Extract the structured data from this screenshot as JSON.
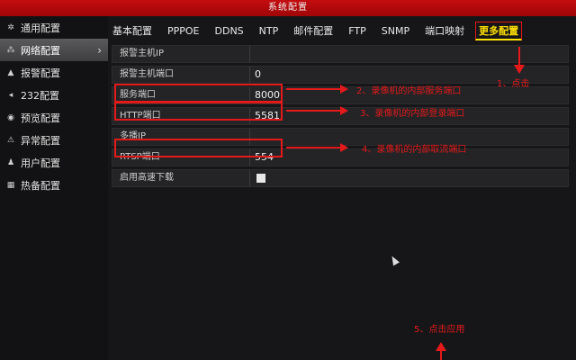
{
  "window": {
    "title": "系统配置"
  },
  "sidebar": {
    "items": [
      {
        "icon": "gear-icon",
        "glyph": "✲",
        "label": "通用配置"
      },
      {
        "icon": "network-icon",
        "glyph": "⁂",
        "label": "网络配置",
        "active": true,
        "chevron": "›"
      },
      {
        "icon": "alarm-icon",
        "glyph": "▲",
        "label": "报警配置"
      },
      {
        "icon": "rs232-icon",
        "glyph": "◂",
        "label": "232配置"
      },
      {
        "icon": "eye-icon",
        "glyph": "◉",
        "label": "预览配置"
      },
      {
        "icon": "warning-icon",
        "glyph": "⚠",
        "label": "异常配置"
      },
      {
        "icon": "user-icon",
        "glyph": "♟",
        "label": "用户配置"
      },
      {
        "icon": "hotspare-icon",
        "glyph": "▦",
        "label": "热备配置"
      }
    ]
  },
  "tabs": [
    {
      "label": "基本配置"
    },
    {
      "label": "PPPOE"
    },
    {
      "label": "DDNS"
    },
    {
      "label": "NTP"
    },
    {
      "label": "邮件配置"
    },
    {
      "label": "FTP"
    },
    {
      "label": "SNMP"
    },
    {
      "label": "端口映射"
    },
    {
      "label": "更多配置",
      "active": true
    }
  ],
  "form": {
    "alarm_host_ip_label": "报警主机IP",
    "alarm_host_ip_value": "",
    "alarm_host_port_label": "报警主机端口",
    "alarm_host_port_value": "0",
    "server_port_label": "服务端口",
    "server_port_value": "8000",
    "http_port_label": "HTTP端口",
    "http_port_value": "5581",
    "multicast_ip_label": "多播IP",
    "multicast_ip_value": "",
    "rtsp_port_label": "RTSP端口",
    "rtsp_port_value": "554",
    "fast_download_label": "启用高速下载",
    "fast_download_checked": true
  },
  "annotations": {
    "step1": "1、点击",
    "step2": "2、录像机的内部服务端口",
    "step3": "3、录像机的内部登录端口",
    "step4": "4、录像机的内部取流端口",
    "step5": "5、点击应用"
  },
  "colors": {
    "title_bar": "#b00a0c",
    "annotation": "#e3191a",
    "active_tab": "#ffe100"
  }
}
